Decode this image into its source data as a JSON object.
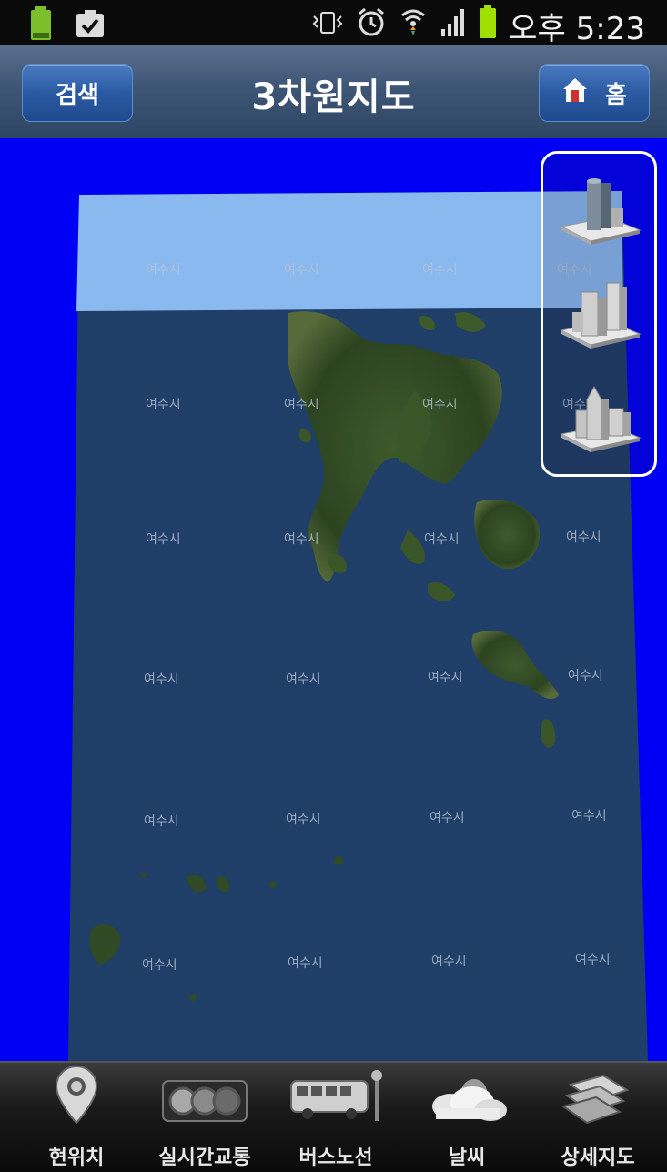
{
  "status_bar": {
    "time": "오후 5:23"
  },
  "header": {
    "search_label": "검색",
    "title": "3차원지도",
    "home_label": "홈"
  },
  "map": {
    "city_label": "여수시",
    "building_buttons": [
      "single-tower-building-icon",
      "office-complex-building-icon",
      "city-block-building-icon"
    ]
  },
  "bottom_nav": [
    {
      "label": "현위치",
      "icon": "location-pin-icon"
    },
    {
      "label": "실시간교통",
      "icon": "traffic-light-icon"
    },
    {
      "label": "버스노선",
      "icon": "bus-icon"
    },
    {
      "label": "날씨",
      "icon": "weather-cloud-icon"
    },
    {
      "label": "상세지도",
      "icon": "detail-map-icon"
    }
  ]
}
